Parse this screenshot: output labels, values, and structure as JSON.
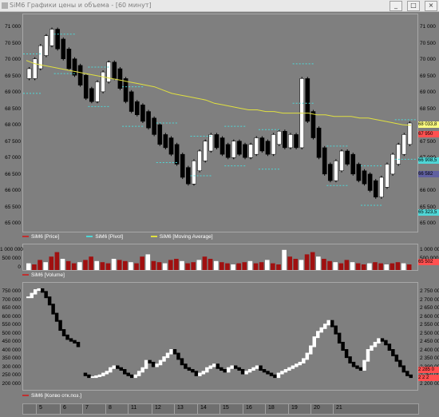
{
  "window": {
    "title": "SiM6 Графики цены и объема - [60 минут]",
    "buttons": {
      "minimize": "_",
      "maximize": "□",
      "close": "×"
    }
  },
  "price_pane": {
    "y_ticks": [
      "71 000",
      "70 500",
      "70 000",
      "69 500",
      "69 000",
      "68 500",
      "68 000",
      "67 500",
      "67 000",
      "66 500",
      "66 000",
      "65 500",
      "65 000"
    ],
    "right_ticks": [
      "71 000",
      "70 500",
      "70 000",
      "69 500",
      "69 000",
      "68 500",
      "68 000",
      "67 500",
      "67 000",
      "66 500",
      "66 000",
      "65 500",
      "65 000"
    ],
    "price_tags": [
      {
        "label": "68 033,8",
        "color": "#ffff80"
      },
      {
        "label": "67 950",
        "color": "#ff5050"
      },
      {
        "label": "66 908,5",
        "color": "#4fd6d6"
      },
      {
        "label": "66 582",
        "color": "#6060a0"
      },
      {
        "label": "65 323,5",
        "color": "#4fd6d6"
      }
    ],
    "legend": [
      {
        "label": "SiM6 [Price]",
        "color": "#c03030"
      },
      {
        "label": "SiM6 [Pivot]",
        "color": "#4fd6d6"
      },
      {
        "label": "SiM6 [Moving Average]",
        "color": "#e0e040"
      }
    ]
  },
  "volume_pane": {
    "y_ticks": [
      "1 000 000",
      "500 000",
      "0"
    ],
    "right_ticks": [
      "1 000 000",
      "500 000"
    ],
    "price_tag": {
      "label": "65 502",
      "color": "#ff5050"
    },
    "legend": [
      {
        "label": "SiM6 [Volume]",
        "color": "#c03030"
      }
    ]
  },
  "oi_pane": {
    "y_ticks": [
      "750 000",
      "700 000",
      "650 000",
      "600 000",
      "550 000",
      "500 000",
      "450 000",
      "400 000",
      "350 000",
      "300 000",
      "250 000",
      "200 000"
    ],
    "right_ticks": [
      "2 750 000",
      "2 700 000",
      "2 650 000",
      "2 600 000",
      "2 550 000",
      "2 500 000",
      "2 450 000",
      "2 400 000",
      "2 350 000",
      "2 300 000",
      "2 250 000",
      "2 200 000"
    ],
    "price_tags": [
      {
        "label": "2 285 0",
        "color": "#ff5050"
      },
      {
        "label": "2 2 2",
        "color": "#ff5050"
      }
    ],
    "legend": [
      {
        "label": "SiM6 [Колво отк.поз.]",
        "color": "#c03030"
      }
    ]
  },
  "x_axis": {
    "ticks": [
      "5",
      "6",
      "7",
      "8",
      "11",
      "12",
      "13",
      "14",
      "15",
      "16",
      "18",
      "19",
      "20",
      "21"
    ]
  },
  "chart_data": {
    "type": "line",
    "title": "",
    "series": [
      {
        "name": "SiM6 [Price]",
        "values": [
          69.6,
          69.9,
          70.3,
          70.6,
          70.8,
          70.5,
          70.2,
          69.9,
          69.7,
          69.4,
          69.0,
          68.9,
          69.2,
          69.5,
          69.8,
          69.6,
          69.3,
          68.9,
          68.6,
          68.5,
          68.3,
          68.1,
          67.9,
          67.6,
          67.5,
          67.3,
          67.0,
          66.6,
          66.4,
          66.8,
          67.1,
          67.4,
          67.6,
          67.5,
          67.3,
          67.2,
          67.4,
          67.3,
          67.2,
          67.3,
          67.5,
          67.4,
          67.3,
          67.6,
          67.7,
          67.5,
          67.6,
          67.5,
          69.3,
          68.3,
          67.8,
          67.2,
          66.7,
          66.5,
          66.8,
          67.1,
          67.0,
          66.7,
          66.5,
          66.4,
          66.2,
          66.0,
          66.3,
          66.7,
          67.0,
          67.3,
          67.6,
          67.95
        ]
      },
      {
        "name": "SiM6 [Moving Average]",
        "values": [
          70.0,
          69.9,
          69.85,
          69.8,
          69.75,
          69.7,
          69.65,
          69.6,
          69.55,
          69.5,
          69.45,
          69.4,
          69.35,
          69.3,
          69.25,
          69.2,
          69.1,
          69.0,
          68.95,
          68.9,
          68.85,
          68.8,
          68.7,
          68.65,
          68.6,
          68.55,
          68.5,
          68.5,
          68.45,
          68.45,
          68.4,
          68.4,
          68.4,
          68.4,
          68.35,
          68.35,
          68.3,
          68.3,
          68.3,
          68.25,
          68.25,
          68.2,
          68.15,
          68.1,
          68.05,
          68.03
        ]
      }
    ],
    "volume": [
      300,
      250,
      450,
      350,
      600,
      800,
      500,
      400,
      300,
      350,
      450,
      600,
      400,
      350,
      300,
      500,
      450,
      400,
      350,
      300,
      600,
      700,
      400,
      350,
      300,
      450,
      500,
      400,
      300,
      350,
      450,
      600,
      500,
      400,
      350,
      300,
      250,
      300,
      350,
      400,
      300,
      350,
      450,
      300,
      250,
      900,
      600,
      500,
      450,
      700,
      800,
      600,
      500,
      400,
      350,
      300,
      450,
      350,
      300,
      250,
      300,
      350,
      300,
      250,
      300,
      350,
      300,
      250
    ],
    "open_interest": [
      690,
      710,
      730,
      735,
      720,
      690,
      650,
      600,
      560,
      510,
      480,
      460,
      450,
      440,
      420,
      270,
      260,
      250,
      250,
      255,
      260,
      270,
      280,
      300,
      310,
      300,
      290,
      270,
      260,
      250,
      260,
      280,
      300,
      340,
      330,
      310,
      320,
      340,
      360,
      380,
      400,
      380,
      350,
      320,
      300,
      290,
      280,
      260,
      270,
      280,
      300,
      310,
      320,
      300,
      290,
      280,
      300,
      310,
      300,
      290,
      270,
      280,
      290,
      300,
      310,
      290,
      280,
      270,
      260,
      250,
      270,
      280,
      290,
      300,
      310,
      320,
      330,
      350,
      380,
      420,
      470,
      500,
      520,
      540,
      560,
      530,
      490,
      440,
      400,
      360,
      330,
      310,
      300,
      290,
      340,
      400,
      420,
      440,
      460,
      450,
      430,
      400,
      370,
      340,
      310,
      280,
      260,
      250
    ]
  }
}
